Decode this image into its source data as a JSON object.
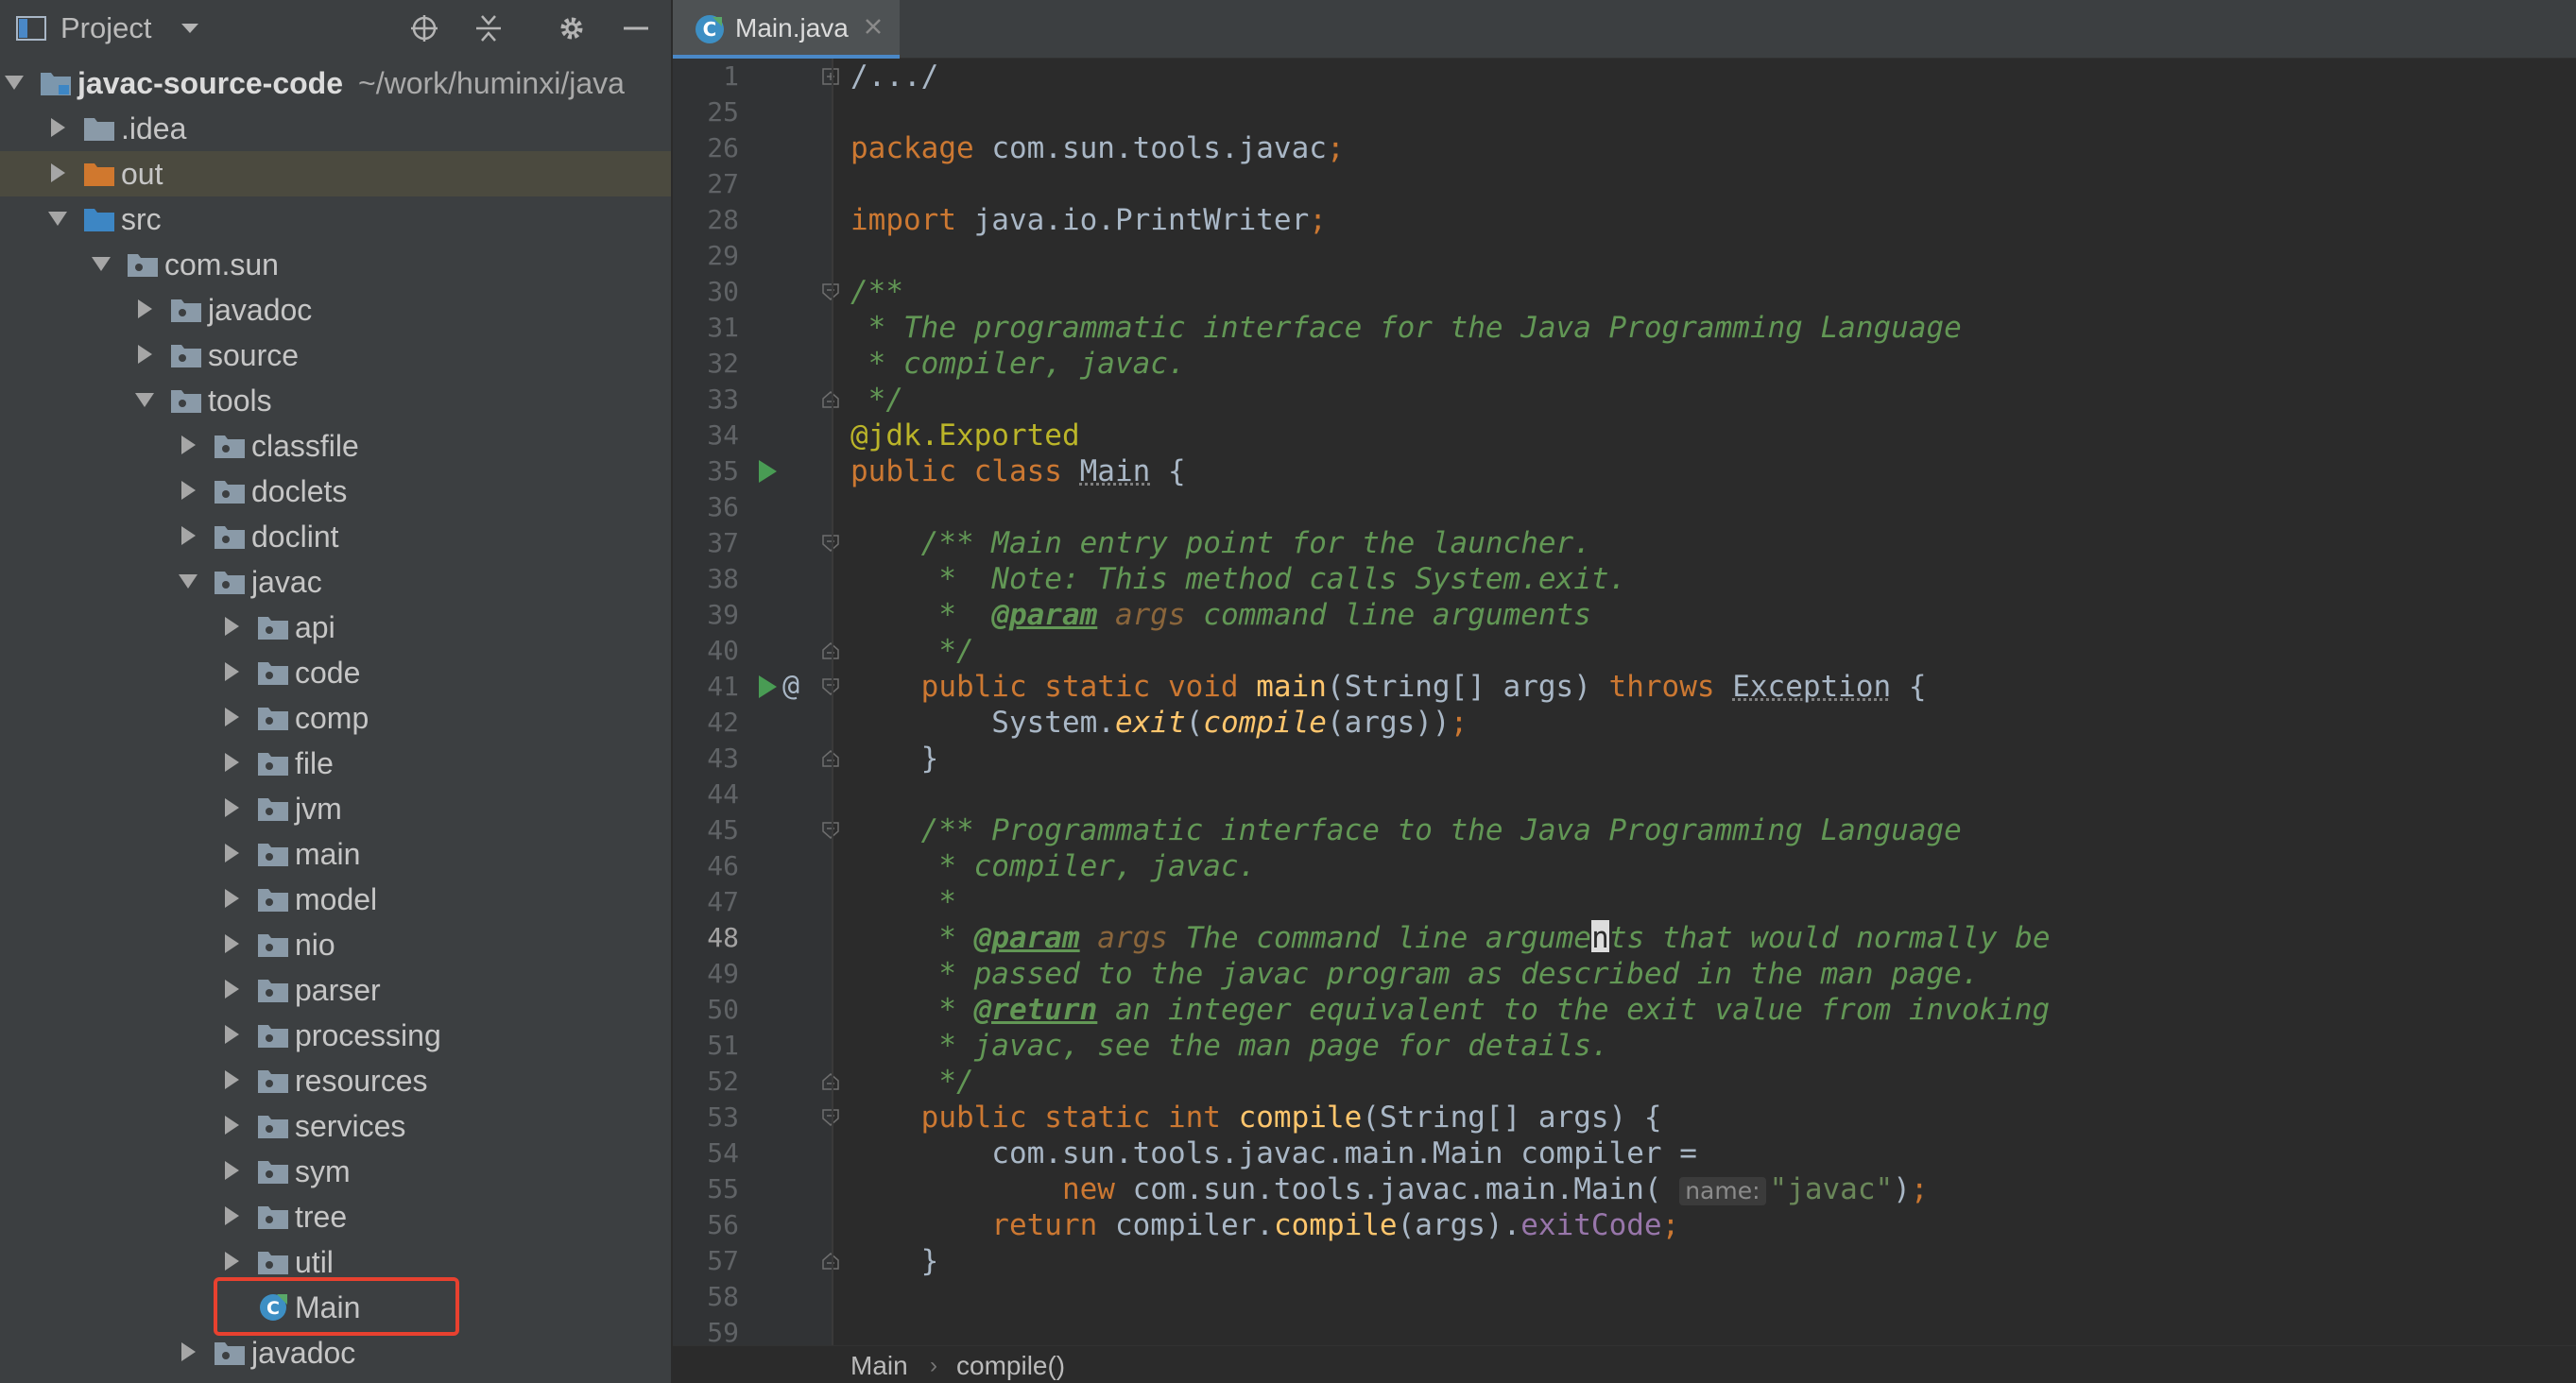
{
  "project_panel": {
    "title": "Project",
    "tree": [
      {
        "label": "javac-source-code",
        "path": "~/work/huminxi/java",
        "depth": 0,
        "expanded": true,
        "icon": "module-folder-icon",
        "root": true
      },
      {
        "label": ".idea",
        "depth": 1,
        "expanded": false,
        "icon": "folder-icon"
      },
      {
        "label": "out",
        "depth": 1,
        "expanded": false,
        "icon": "excluded-folder-icon",
        "selected": true
      },
      {
        "label": "src",
        "depth": 1,
        "expanded": true,
        "icon": "source-folder-icon"
      },
      {
        "label": "com.sun",
        "depth": 2,
        "expanded": true,
        "icon": "package-icon"
      },
      {
        "label": "javadoc",
        "depth": 3,
        "expanded": false,
        "icon": "package-icon"
      },
      {
        "label": "source",
        "depth": 3,
        "expanded": false,
        "icon": "package-icon"
      },
      {
        "label": "tools",
        "depth": 3,
        "expanded": true,
        "icon": "package-icon"
      },
      {
        "label": "classfile",
        "depth": 4,
        "expanded": false,
        "icon": "package-icon"
      },
      {
        "label": "doclets",
        "depth": 4,
        "expanded": false,
        "icon": "package-icon"
      },
      {
        "label": "doclint",
        "depth": 4,
        "expanded": false,
        "icon": "package-icon"
      },
      {
        "label": "javac",
        "depth": 4,
        "expanded": true,
        "icon": "package-icon"
      },
      {
        "label": "api",
        "depth": 5,
        "expanded": false,
        "icon": "package-icon"
      },
      {
        "label": "code",
        "depth": 5,
        "expanded": false,
        "icon": "package-icon"
      },
      {
        "label": "comp",
        "depth": 5,
        "expanded": false,
        "icon": "package-icon"
      },
      {
        "label": "file",
        "depth": 5,
        "expanded": false,
        "icon": "package-icon"
      },
      {
        "label": "jvm",
        "depth": 5,
        "expanded": false,
        "icon": "package-icon"
      },
      {
        "label": "main",
        "depth": 5,
        "expanded": false,
        "icon": "package-icon"
      },
      {
        "label": "model",
        "depth": 5,
        "expanded": false,
        "icon": "package-icon"
      },
      {
        "label": "nio",
        "depth": 5,
        "expanded": false,
        "icon": "package-icon"
      },
      {
        "label": "parser",
        "depth": 5,
        "expanded": false,
        "icon": "package-icon"
      },
      {
        "label": "processing",
        "depth": 5,
        "expanded": false,
        "icon": "package-icon"
      },
      {
        "label": "resources",
        "depth": 5,
        "expanded": false,
        "icon": "package-icon"
      },
      {
        "label": "services",
        "depth": 5,
        "expanded": false,
        "icon": "package-icon"
      },
      {
        "label": "sym",
        "depth": 5,
        "expanded": false,
        "icon": "package-icon"
      },
      {
        "label": "tree",
        "depth": 5,
        "expanded": false,
        "icon": "package-icon"
      },
      {
        "label": "util",
        "depth": 5,
        "expanded": false,
        "icon": "package-icon"
      },
      {
        "label": "Main",
        "depth": 5,
        "leaf": true,
        "icon": "java-class-icon",
        "highlighted": true
      },
      {
        "label": "javadoc",
        "depth": 4,
        "expanded": false,
        "icon": "package-icon"
      }
    ]
  },
  "editor": {
    "tab": {
      "label": "Main.java",
      "icon": "java-class-icon"
    },
    "current_line": "48",
    "lines": [
      {
        "num": "1",
        "fold": "plus",
        "tokens": [
          [
            "fold-text",
            "/.../"
          ]
        ]
      },
      {
        "num": "25",
        "tokens": []
      },
      {
        "num": "26",
        "tokens": [
          [
            "kw",
            "package"
          ],
          [
            "plain",
            " com.sun.tools.javac"
          ],
          [
            "semi",
            ";"
          ]
        ]
      },
      {
        "num": "27",
        "tokens": []
      },
      {
        "num": "28",
        "tokens": [
          [
            "kw",
            "import"
          ],
          [
            "plain",
            " java.io.PrintWriter"
          ],
          [
            "semi",
            ";"
          ]
        ]
      },
      {
        "num": "29",
        "tokens": []
      },
      {
        "num": "30",
        "fold": "open",
        "tokens": [
          [
            "cmt",
            "/**"
          ]
        ]
      },
      {
        "num": "31",
        "tokens": [
          [
            "cmt",
            " * The programmatic interface for the Java Programming Language"
          ]
        ]
      },
      {
        "num": "32",
        "tokens": [
          [
            "cmt",
            " * compiler, javac."
          ]
        ]
      },
      {
        "num": "33",
        "fold": "close",
        "tokens": [
          [
            "cmt",
            " */"
          ]
        ]
      },
      {
        "num": "34",
        "tokens": [
          [
            "ann",
            "@jdk.Exported"
          ]
        ]
      },
      {
        "num": "35",
        "run": true,
        "tokens": [
          [
            "kw",
            "public class "
          ],
          [
            "plain-u",
            "Main"
          ],
          [
            "plain",
            " {"
          ]
        ]
      },
      {
        "num": "36",
        "tokens": []
      },
      {
        "num": "37",
        "fold": "open",
        "tokens": [
          [
            "cmt",
            "    /** Main entry point for the launcher."
          ]
        ]
      },
      {
        "num": "38",
        "tokens": [
          [
            "cmt",
            "     *  Note: This method calls System.exit."
          ]
        ]
      },
      {
        "num": "39",
        "tokens": [
          [
            "cmt",
            "     *  "
          ],
          [
            "doc-tag",
            "@param"
          ],
          [
            "doc-arg",
            " args"
          ],
          [
            "cmt",
            " command line arguments"
          ]
        ]
      },
      {
        "num": "40",
        "fold": "close",
        "tokens": [
          [
            "cmt",
            "     */"
          ]
        ]
      },
      {
        "num": "41",
        "run": true,
        "override": "@",
        "fold": "open",
        "tokens": [
          [
            "kw",
            "    public static void "
          ],
          [
            "method",
            "main"
          ],
          [
            "plain",
            "(String[] args) "
          ],
          [
            "kw",
            "throws "
          ],
          [
            "plain-u",
            "Exception"
          ],
          [
            "plain",
            " {"
          ]
        ]
      },
      {
        "num": "42",
        "tokens": [
          [
            "plain",
            "        System."
          ],
          [
            "static-call",
            "exit"
          ],
          [
            "plain",
            "("
          ],
          [
            "static-call",
            "compile"
          ],
          [
            "plain",
            "(args))"
          ],
          [
            "semi",
            ";"
          ]
        ]
      },
      {
        "num": "43",
        "fold": "close",
        "tokens": [
          [
            "plain",
            "    }"
          ]
        ]
      },
      {
        "num": "44",
        "tokens": []
      },
      {
        "num": "45",
        "fold": "open",
        "tokens": [
          [
            "cmt",
            "    /** Programmatic interface to the Java Programming Language"
          ]
        ]
      },
      {
        "num": "46",
        "tokens": [
          [
            "cmt",
            "     * compiler, javac."
          ]
        ]
      },
      {
        "num": "47",
        "tokens": [
          [
            "cmt",
            "     *"
          ]
        ]
      },
      {
        "num": "48",
        "tokens": [
          [
            "cmt",
            "     * "
          ],
          [
            "doc-tag",
            "@param"
          ],
          [
            "doc-arg",
            " args"
          ],
          [
            "cmt",
            " The command line argume"
          ],
          [
            "caret",
            "n"
          ],
          [
            "cmt",
            "ts that would normally be"
          ]
        ]
      },
      {
        "num": "49",
        "tokens": [
          [
            "cmt",
            "     * passed to the javac program as described in the man page."
          ]
        ]
      },
      {
        "num": "50",
        "tokens": [
          [
            "cmt",
            "     * "
          ],
          [
            "doc-tag",
            "@return"
          ],
          [
            "cmt",
            " an integer equivalent to the exit value from invoking"
          ]
        ]
      },
      {
        "num": "51",
        "tokens": [
          [
            "cmt",
            "     * javac, see the man page for details."
          ]
        ]
      },
      {
        "num": "52",
        "fold": "close",
        "tokens": [
          [
            "cmt",
            "     */"
          ]
        ]
      },
      {
        "num": "53",
        "fold": "open",
        "tokens": [
          [
            "kw",
            "    public static int "
          ],
          [
            "method",
            "compile"
          ],
          [
            "plain",
            "(String[] args) {"
          ]
        ]
      },
      {
        "num": "54",
        "tokens": [
          [
            "plain",
            "        com.sun.tools.javac.main.Main compiler ="
          ]
        ]
      },
      {
        "num": "55",
        "tokens": [
          [
            "kw",
            "            new "
          ],
          [
            "plain",
            "com.sun.tools.javac.main.Main( "
          ],
          [
            "hint",
            "name:"
          ],
          [
            "str",
            "\"javac\""
          ],
          [
            "plain",
            ")"
          ],
          [
            "semi",
            ";"
          ]
        ]
      },
      {
        "num": "56",
        "tokens": [
          [
            "kw",
            "        return "
          ],
          [
            "plain",
            "compiler."
          ],
          [
            "method",
            "compile"
          ],
          [
            "plain",
            "(args)."
          ],
          [
            "field",
            "exitCode"
          ],
          [
            "semi",
            ";"
          ]
        ]
      },
      {
        "num": "57",
        "fold": "close",
        "tokens": [
          [
            "plain",
            "    }"
          ]
        ]
      },
      {
        "num": "58",
        "tokens": []
      },
      {
        "num": "59",
        "tokens": []
      }
    ],
    "breadcrumb": [
      "Main",
      "compile()"
    ]
  }
}
